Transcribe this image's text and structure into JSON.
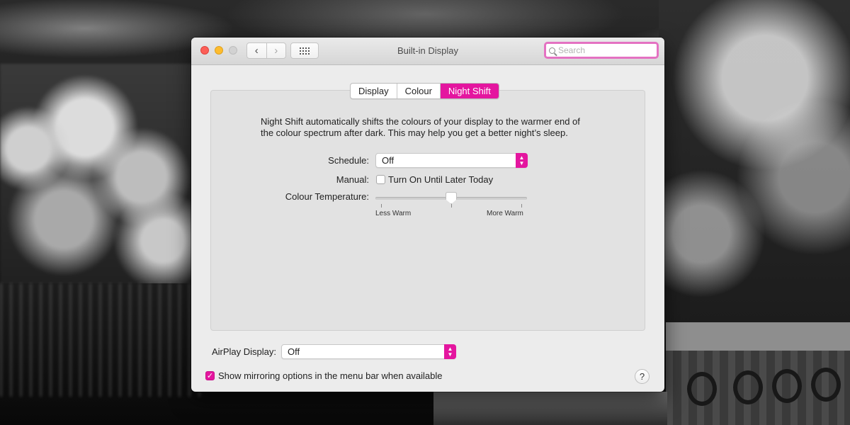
{
  "window": {
    "title": "Built-in Display",
    "nav_back": "‹",
    "nav_forward": "›"
  },
  "search": {
    "placeholder": "Search"
  },
  "tabs": [
    {
      "label": "Display",
      "active": false
    },
    {
      "label": "Colour",
      "active": false
    },
    {
      "label": "Night Shift",
      "active": true
    }
  ],
  "night_shift": {
    "description_line1": "Night Shift automatically shifts the colours of your display to the warmer end of",
    "description_line2": "the colour spectrum after dark. This may help you get a better night’s sleep.",
    "schedule_label": "Schedule:",
    "schedule_value": "Off",
    "manual_label": "Manual:",
    "manual_checkbox_label": "Turn On Until Later Today",
    "manual_checked": false,
    "temperature_label": "Colour Temperature:",
    "temperature_min_label": "Less Warm",
    "temperature_max_label": "More Warm",
    "temperature_level": 0.5
  },
  "airplay": {
    "label": "AirPlay Display:",
    "value": "Off"
  },
  "mirroring": {
    "label": "Show mirroring options in the menu bar when available",
    "checked": true
  },
  "help_label": "?",
  "colors": {
    "accent": "#e4169f",
    "search_focus": "#e472c2",
    "close": "#fc5f57",
    "minimize": "#fdbc2e",
    "zoom_disabled": "#d2d2d2"
  }
}
